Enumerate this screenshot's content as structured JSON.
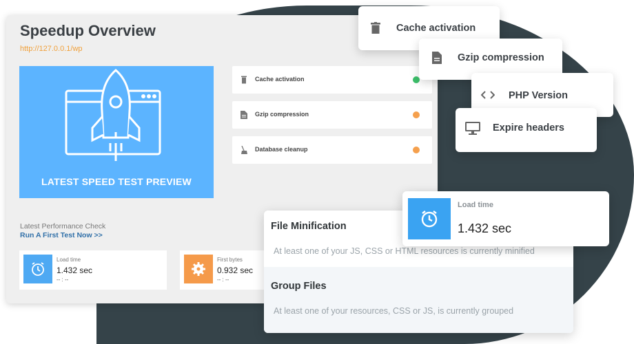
{
  "panel": {
    "title": "Speedup Overview",
    "url": "http://127.0.0.1/wp",
    "preview_label": "LATEST SPEED TEST PREVIEW",
    "checks": [
      {
        "label": "Cache activation",
        "icon": "trash-icon",
        "status": "ok"
      },
      {
        "label": "Gzip compression",
        "icon": "file-icon",
        "status": "warning"
      },
      {
        "label": "Database cleanup",
        "icon": "broom-icon",
        "status": "warning"
      }
    ],
    "performance_title": "Latest Performance Check",
    "performance_link": "Run A First Test Now >>",
    "stats": [
      {
        "label": "Load time",
        "value": "1.432 sec",
        "sub": "-- : --",
        "icon": "alarm-clock-icon",
        "color": "#4ea9f3"
      },
      {
        "label": "First bytes",
        "value": "0.932 sec",
        "sub": "-- : --",
        "icon": "gear-icon",
        "color": "#f59a4a"
      }
    ]
  },
  "floating": {
    "cache": "Cache activation",
    "gzip": "Gzip compression",
    "php": "PHP Version",
    "expire": "Expire headers"
  },
  "minify": {
    "title1": "File Minification",
    "desc1": "At least one of your JS, CSS or HTML resources is currently minified",
    "title2": "Group Files",
    "desc2": "At least one of your resources, CSS or JS, is currently grouped"
  },
  "load_card": {
    "label": "Load time",
    "value": "1.432 sec",
    "icon": "alarm-clock-icon"
  },
  "colors": {
    "accent_blue": "#5cb4ff",
    "accent_orange": "#f59a4a",
    "url_orange": "#f0a03a",
    "link_blue": "#2f6fa8",
    "ok_green": "#3cbf6a",
    "background_blob": "#354349"
  }
}
